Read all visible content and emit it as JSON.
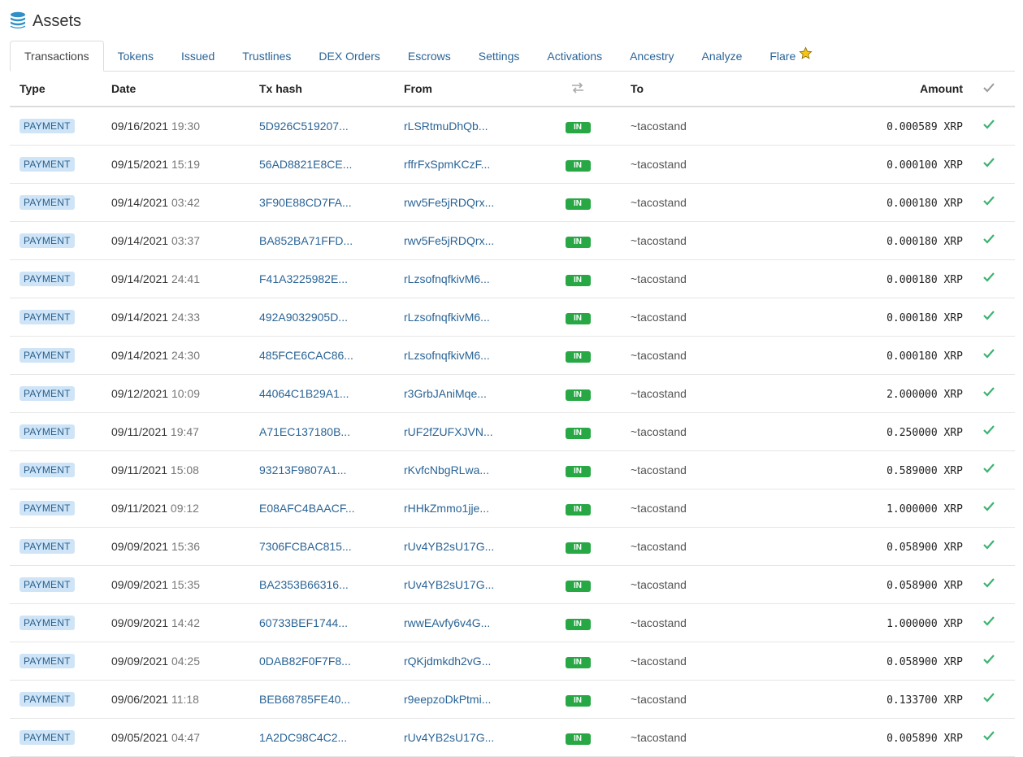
{
  "header": {
    "title": "Assets",
    "icon": "database-icon"
  },
  "tabs": [
    {
      "label": "Transactions",
      "active": true
    },
    {
      "label": "Tokens"
    },
    {
      "label": "Issued"
    },
    {
      "label": "Trustlines"
    },
    {
      "label": "DEX Orders"
    },
    {
      "label": "Escrows"
    },
    {
      "label": "Settings"
    },
    {
      "label": "Activations"
    },
    {
      "label": "Ancestry"
    },
    {
      "label": "Analyze"
    },
    {
      "label": "Flare",
      "icon": "star-icon"
    }
  ],
  "table": {
    "columns": {
      "type": "Type",
      "date": "Date",
      "hash": "Tx hash",
      "from": "From",
      "direction_icon": "swap-icon",
      "to": "To",
      "amount": "Amount",
      "status_icon": "check-icon"
    },
    "rows": [
      {
        "type": "PAYMENT",
        "date": "09/16/2021",
        "time": "19:30",
        "hash": "5D926C519207...",
        "from": "rLSRtmuDhQb...",
        "dir": "IN",
        "to": "~tacostand",
        "amount": "0.000589 XRP"
      },
      {
        "type": "PAYMENT",
        "date": "09/15/2021",
        "time": "15:19",
        "hash": "56AD8821E8CE...",
        "from": "rffrFxSpmKCzF...",
        "dir": "IN",
        "to": "~tacostand",
        "amount": "0.000100 XRP"
      },
      {
        "type": "PAYMENT",
        "date": "09/14/2021",
        "time": "03:42",
        "hash": "3F90E88CD7FA...",
        "from": "rwv5Fe5jRDQrx...",
        "dir": "IN",
        "to": "~tacostand",
        "amount": "0.000180 XRP"
      },
      {
        "type": "PAYMENT",
        "date": "09/14/2021",
        "time": "03:37",
        "hash": "BA852BA71FFD...",
        "from": "rwv5Fe5jRDQrx...",
        "dir": "IN",
        "to": "~tacostand",
        "amount": "0.000180 XRP"
      },
      {
        "type": "PAYMENT",
        "date": "09/14/2021",
        "time": "24:41",
        "hash": "F41A3225982E...",
        "from": "rLzsofnqfkivM6...",
        "dir": "IN",
        "to": "~tacostand",
        "amount": "0.000180 XRP"
      },
      {
        "type": "PAYMENT",
        "date": "09/14/2021",
        "time": "24:33",
        "hash": "492A9032905D...",
        "from": "rLzsofnqfkivM6...",
        "dir": "IN",
        "to": "~tacostand",
        "amount": "0.000180 XRP"
      },
      {
        "type": "PAYMENT",
        "date": "09/14/2021",
        "time": "24:30",
        "hash": "485FCE6CAC86...",
        "from": "rLzsofnqfkivM6...",
        "dir": "IN",
        "to": "~tacostand",
        "amount": "0.000180 XRP"
      },
      {
        "type": "PAYMENT",
        "date": "09/12/2021",
        "time": "10:09",
        "hash": "44064C1B29A1...",
        "from": "r3GrbJAniMqe...",
        "dir": "IN",
        "to": "~tacostand",
        "amount": "2.000000 XRP"
      },
      {
        "type": "PAYMENT",
        "date": "09/11/2021",
        "time": "19:47",
        "hash": "A71EC137180B...",
        "from": "rUF2fZUFXJVN...",
        "dir": "IN",
        "to": "~tacostand",
        "amount": "0.250000 XRP"
      },
      {
        "type": "PAYMENT",
        "date": "09/11/2021",
        "time": "15:08",
        "hash": "93213F9807A1...",
        "from": "rKvfcNbgRLwa...",
        "dir": "IN",
        "to": "~tacostand",
        "amount": "0.589000 XRP"
      },
      {
        "type": "PAYMENT",
        "date": "09/11/2021",
        "time": "09:12",
        "hash": "E08AFC4BAACF...",
        "from": "rHHkZmmo1jje...",
        "dir": "IN",
        "to": "~tacostand",
        "amount": "1.000000 XRP"
      },
      {
        "type": "PAYMENT",
        "date": "09/09/2021",
        "time": "15:36",
        "hash": "7306FCBAC815...",
        "from": "rUv4YB2sU17G...",
        "dir": "IN",
        "to": "~tacostand",
        "amount": "0.058900 XRP"
      },
      {
        "type": "PAYMENT",
        "date": "09/09/2021",
        "time": "15:35",
        "hash": "BA2353B66316...",
        "from": "rUv4YB2sU17G...",
        "dir": "IN",
        "to": "~tacostand",
        "amount": "0.058900 XRP"
      },
      {
        "type": "PAYMENT",
        "date": "09/09/2021",
        "time": "14:42",
        "hash": "60733BEF1744...",
        "from": "rwwEAvfy6v4G...",
        "dir": "IN",
        "to": "~tacostand",
        "amount": "1.000000 XRP"
      },
      {
        "type": "PAYMENT",
        "date": "09/09/2021",
        "time": "04:25",
        "hash": "0DAB82F0F7F8...",
        "from": "rQKjdmkdh2vG...",
        "dir": "IN",
        "to": "~tacostand",
        "amount": "0.058900 XRP"
      },
      {
        "type": "PAYMENT",
        "date": "09/06/2021",
        "time": "11:18",
        "hash": "BEB68785FE40...",
        "from": "r9eepzoDkPtmi...",
        "dir": "IN",
        "to": "~tacostand",
        "amount": "0.133700 XRP"
      },
      {
        "type": "PAYMENT",
        "date": "09/05/2021",
        "time": "04:47",
        "hash": "1A2DC98C4C2...",
        "from": "rUv4YB2sU17G...",
        "dir": "IN",
        "to": "~tacostand",
        "amount": "0.005890 XRP"
      }
    ]
  },
  "colors": {
    "link": "#2a6496",
    "in_badge": "#28a745",
    "type_badge_bg": "#cfe5f7",
    "check": "#3cb371"
  }
}
